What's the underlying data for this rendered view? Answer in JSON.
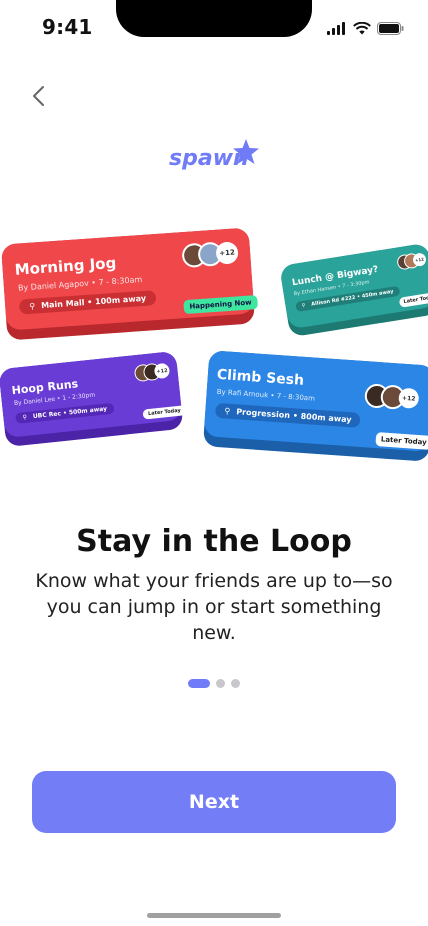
{
  "status_bar": {
    "time": "9:41"
  },
  "logo": {
    "text": "spawn"
  },
  "cards": [
    {
      "title": "Morning Jog",
      "subtitle": "By Daniel Agapov • 7 - 8:30am",
      "location": "Main Mall • 100m away",
      "tag": "Happening Now",
      "plus": "+12"
    },
    {
      "title": "Lunch @ Bigway?",
      "subtitle": "By Ethan Hansen • 7 - 3:30pm",
      "location": "Allison Rd #222 • 450m away",
      "tag": "Later Today",
      "plus": "+12"
    },
    {
      "title": "Hoop Runs",
      "subtitle": "By Daniel Lee • 1 - 2:30pm",
      "location": "UBC Rec • 500m away",
      "tag": "Later Today",
      "plus": "+12"
    },
    {
      "title": "Climb Sesh",
      "subtitle": "By Rafi Arnouk • 7 - 8:30am",
      "location": "Progression • 800m away",
      "tag": "Later Today",
      "plus": "+12"
    }
  ],
  "headline": "Stay in the Loop",
  "description": "Know what your friends are up to—so you can jump in or start something new.",
  "pagination": {
    "count": 3,
    "active": 1
  },
  "next_button": "Next",
  "colors": {
    "accent": "#737ef6",
    "red": "#f0474b",
    "teal": "#2aa39a",
    "purple": "#6a3cd6",
    "blue": "#2b86e6",
    "green_tag": "#3ee6a0"
  }
}
